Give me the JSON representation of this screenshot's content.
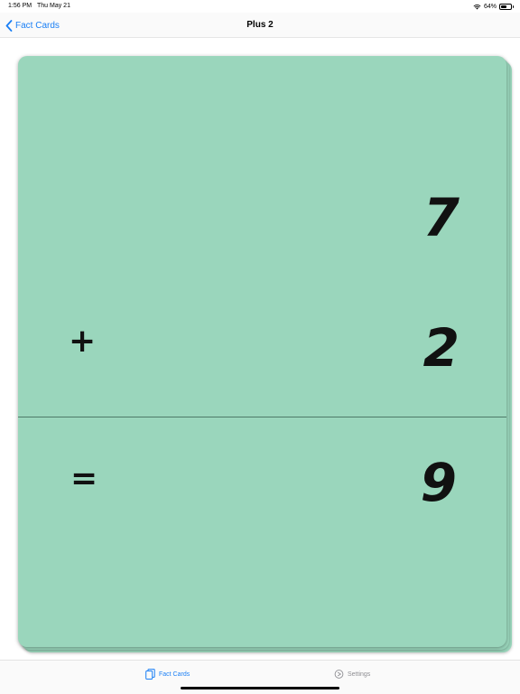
{
  "status_bar": {
    "time": "1:56 PM",
    "date": "Thu May 21",
    "battery_percent": "64%",
    "battery_level": 0.64,
    "icons": [
      "wifi-icon",
      "battery-icon"
    ]
  },
  "nav": {
    "back_label": "Fact Cards",
    "back_icon": "chevron-left-icon",
    "title": "Plus 2"
  },
  "card": {
    "background_color": "#9ad6bc",
    "first_number": "7",
    "operator": "+",
    "second_number": "2",
    "equals": "=",
    "answer": "9"
  },
  "tab_bar": {
    "active_color": "#1a7ff5",
    "inactive_color": "#8e8e93",
    "tabs": [
      {
        "label": "Fact Cards",
        "icon": "cards-icon",
        "active": true
      },
      {
        "label": "Settings",
        "icon": "settings-icon",
        "active": false
      }
    ]
  }
}
